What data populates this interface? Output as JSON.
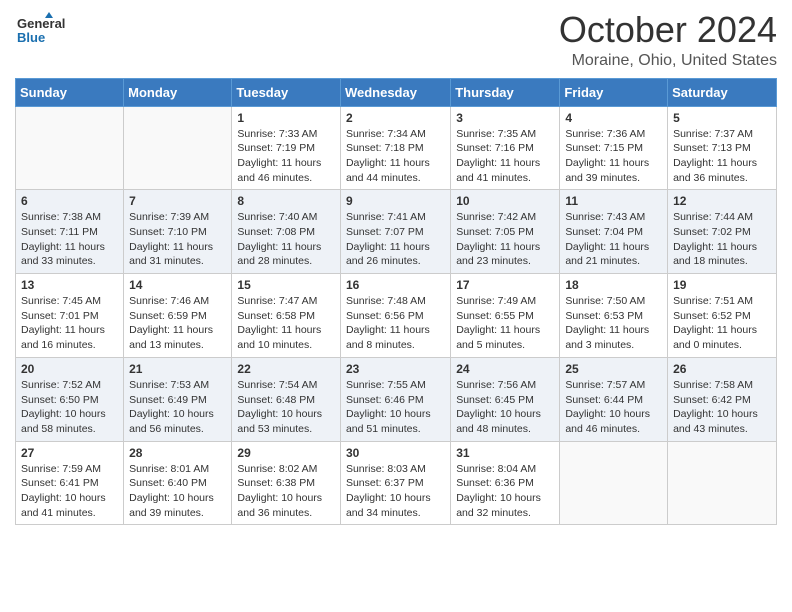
{
  "header": {
    "logo_line1": "General",
    "logo_line2": "Blue",
    "title": "October 2024",
    "subtitle": "Moraine, Ohio, United States"
  },
  "days_of_week": [
    "Sunday",
    "Monday",
    "Tuesday",
    "Wednesday",
    "Thursday",
    "Friday",
    "Saturday"
  ],
  "weeks": [
    [
      {
        "day": "",
        "info": ""
      },
      {
        "day": "",
        "info": ""
      },
      {
        "day": "1",
        "info": "Sunrise: 7:33 AM\nSunset: 7:19 PM\nDaylight: 11 hours and 46 minutes."
      },
      {
        "day": "2",
        "info": "Sunrise: 7:34 AM\nSunset: 7:18 PM\nDaylight: 11 hours and 44 minutes."
      },
      {
        "day": "3",
        "info": "Sunrise: 7:35 AM\nSunset: 7:16 PM\nDaylight: 11 hours and 41 minutes."
      },
      {
        "day": "4",
        "info": "Sunrise: 7:36 AM\nSunset: 7:15 PM\nDaylight: 11 hours and 39 minutes."
      },
      {
        "day": "5",
        "info": "Sunrise: 7:37 AM\nSunset: 7:13 PM\nDaylight: 11 hours and 36 minutes."
      }
    ],
    [
      {
        "day": "6",
        "info": "Sunrise: 7:38 AM\nSunset: 7:11 PM\nDaylight: 11 hours and 33 minutes."
      },
      {
        "day": "7",
        "info": "Sunrise: 7:39 AM\nSunset: 7:10 PM\nDaylight: 11 hours and 31 minutes."
      },
      {
        "day": "8",
        "info": "Sunrise: 7:40 AM\nSunset: 7:08 PM\nDaylight: 11 hours and 28 minutes."
      },
      {
        "day": "9",
        "info": "Sunrise: 7:41 AM\nSunset: 7:07 PM\nDaylight: 11 hours and 26 minutes."
      },
      {
        "day": "10",
        "info": "Sunrise: 7:42 AM\nSunset: 7:05 PM\nDaylight: 11 hours and 23 minutes."
      },
      {
        "day": "11",
        "info": "Sunrise: 7:43 AM\nSunset: 7:04 PM\nDaylight: 11 hours and 21 minutes."
      },
      {
        "day": "12",
        "info": "Sunrise: 7:44 AM\nSunset: 7:02 PM\nDaylight: 11 hours and 18 minutes."
      }
    ],
    [
      {
        "day": "13",
        "info": "Sunrise: 7:45 AM\nSunset: 7:01 PM\nDaylight: 11 hours and 16 minutes."
      },
      {
        "day": "14",
        "info": "Sunrise: 7:46 AM\nSunset: 6:59 PM\nDaylight: 11 hours and 13 minutes."
      },
      {
        "day": "15",
        "info": "Sunrise: 7:47 AM\nSunset: 6:58 PM\nDaylight: 11 hours and 10 minutes."
      },
      {
        "day": "16",
        "info": "Sunrise: 7:48 AM\nSunset: 6:56 PM\nDaylight: 11 hours and 8 minutes."
      },
      {
        "day": "17",
        "info": "Sunrise: 7:49 AM\nSunset: 6:55 PM\nDaylight: 11 hours and 5 minutes."
      },
      {
        "day": "18",
        "info": "Sunrise: 7:50 AM\nSunset: 6:53 PM\nDaylight: 11 hours and 3 minutes."
      },
      {
        "day": "19",
        "info": "Sunrise: 7:51 AM\nSunset: 6:52 PM\nDaylight: 11 hours and 0 minutes."
      }
    ],
    [
      {
        "day": "20",
        "info": "Sunrise: 7:52 AM\nSunset: 6:50 PM\nDaylight: 10 hours and 58 minutes."
      },
      {
        "day": "21",
        "info": "Sunrise: 7:53 AM\nSunset: 6:49 PM\nDaylight: 10 hours and 56 minutes."
      },
      {
        "day": "22",
        "info": "Sunrise: 7:54 AM\nSunset: 6:48 PM\nDaylight: 10 hours and 53 minutes."
      },
      {
        "day": "23",
        "info": "Sunrise: 7:55 AM\nSunset: 6:46 PM\nDaylight: 10 hours and 51 minutes."
      },
      {
        "day": "24",
        "info": "Sunrise: 7:56 AM\nSunset: 6:45 PM\nDaylight: 10 hours and 48 minutes."
      },
      {
        "day": "25",
        "info": "Sunrise: 7:57 AM\nSunset: 6:44 PM\nDaylight: 10 hours and 46 minutes."
      },
      {
        "day": "26",
        "info": "Sunrise: 7:58 AM\nSunset: 6:42 PM\nDaylight: 10 hours and 43 minutes."
      }
    ],
    [
      {
        "day": "27",
        "info": "Sunrise: 7:59 AM\nSunset: 6:41 PM\nDaylight: 10 hours and 41 minutes."
      },
      {
        "day": "28",
        "info": "Sunrise: 8:01 AM\nSunset: 6:40 PM\nDaylight: 10 hours and 39 minutes."
      },
      {
        "day": "29",
        "info": "Sunrise: 8:02 AM\nSunset: 6:38 PM\nDaylight: 10 hours and 36 minutes."
      },
      {
        "day": "30",
        "info": "Sunrise: 8:03 AM\nSunset: 6:37 PM\nDaylight: 10 hours and 34 minutes."
      },
      {
        "day": "31",
        "info": "Sunrise: 8:04 AM\nSunset: 6:36 PM\nDaylight: 10 hours and 32 minutes."
      },
      {
        "day": "",
        "info": ""
      },
      {
        "day": "",
        "info": ""
      }
    ]
  ]
}
